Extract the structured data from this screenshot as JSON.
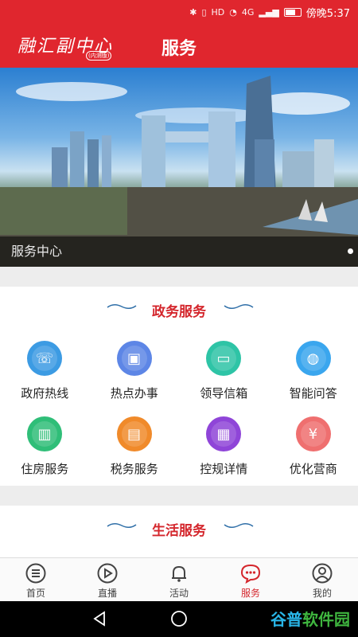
{
  "status": {
    "icons": [
      "bluetooth-icon",
      "vibrate-icon",
      "hd-icon",
      "wifi-icon",
      "4g-icon",
      "signal-icon",
      "battery-icon"
    ],
    "hd": "HD",
    "net": "4G",
    "time": "傍晚5:37"
  },
  "header": {
    "logo": "融汇副中心",
    "logo_sub": "(内测版)",
    "title": "服务"
  },
  "banner": {
    "caption": "服务中心"
  },
  "gov": {
    "title": "政务服务",
    "items": [
      {
        "label": "政府热线",
        "icon": "phone-icon",
        "color": "#3c9be3"
      },
      {
        "label": "热点办事",
        "icon": "shop-icon",
        "color": "#5d86e6"
      },
      {
        "label": "领导信箱",
        "icon": "wallet-icon",
        "color": "#2ec4a6"
      },
      {
        "label": "智能问答",
        "icon": "bag-icon",
        "color": "#3aa6ee"
      },
      {
        "label": "住房服务",
        "icon": "building-icon",
        "color": "#2fbe78"
      },
      {
        "label": "税务服务",
        "icon": "ticket-icon",
        "color": "#f08a2a"
      },
      {
        "label": "控规详情",
        "icon": "document-icon",
        "color": "#8f45d8"
      },
      {
        "label": "优化营商",
        "icon": "money-icon",
        "color": "#ef6f6f"
      }
    ]
  },
  "life": {
    "title": "生活服务"
  },
  "tabs": [
    {
      "label": "首页",
      "icon": "menu-icon"
    },
    {
      "label": "直播",
      "icon": "play-icon"
    },
    {
      "label": "活动",
      "icon": "bell-icon"
    },
    {
      "label": "服务",
      "icon": "chat-icon"
    },
    {
      "label": "我的",
      "icon": "user-icon"
    }
  ],
  "watermark": {
    "part1": "谷普",
    "part2": "软件园"
  }
}
